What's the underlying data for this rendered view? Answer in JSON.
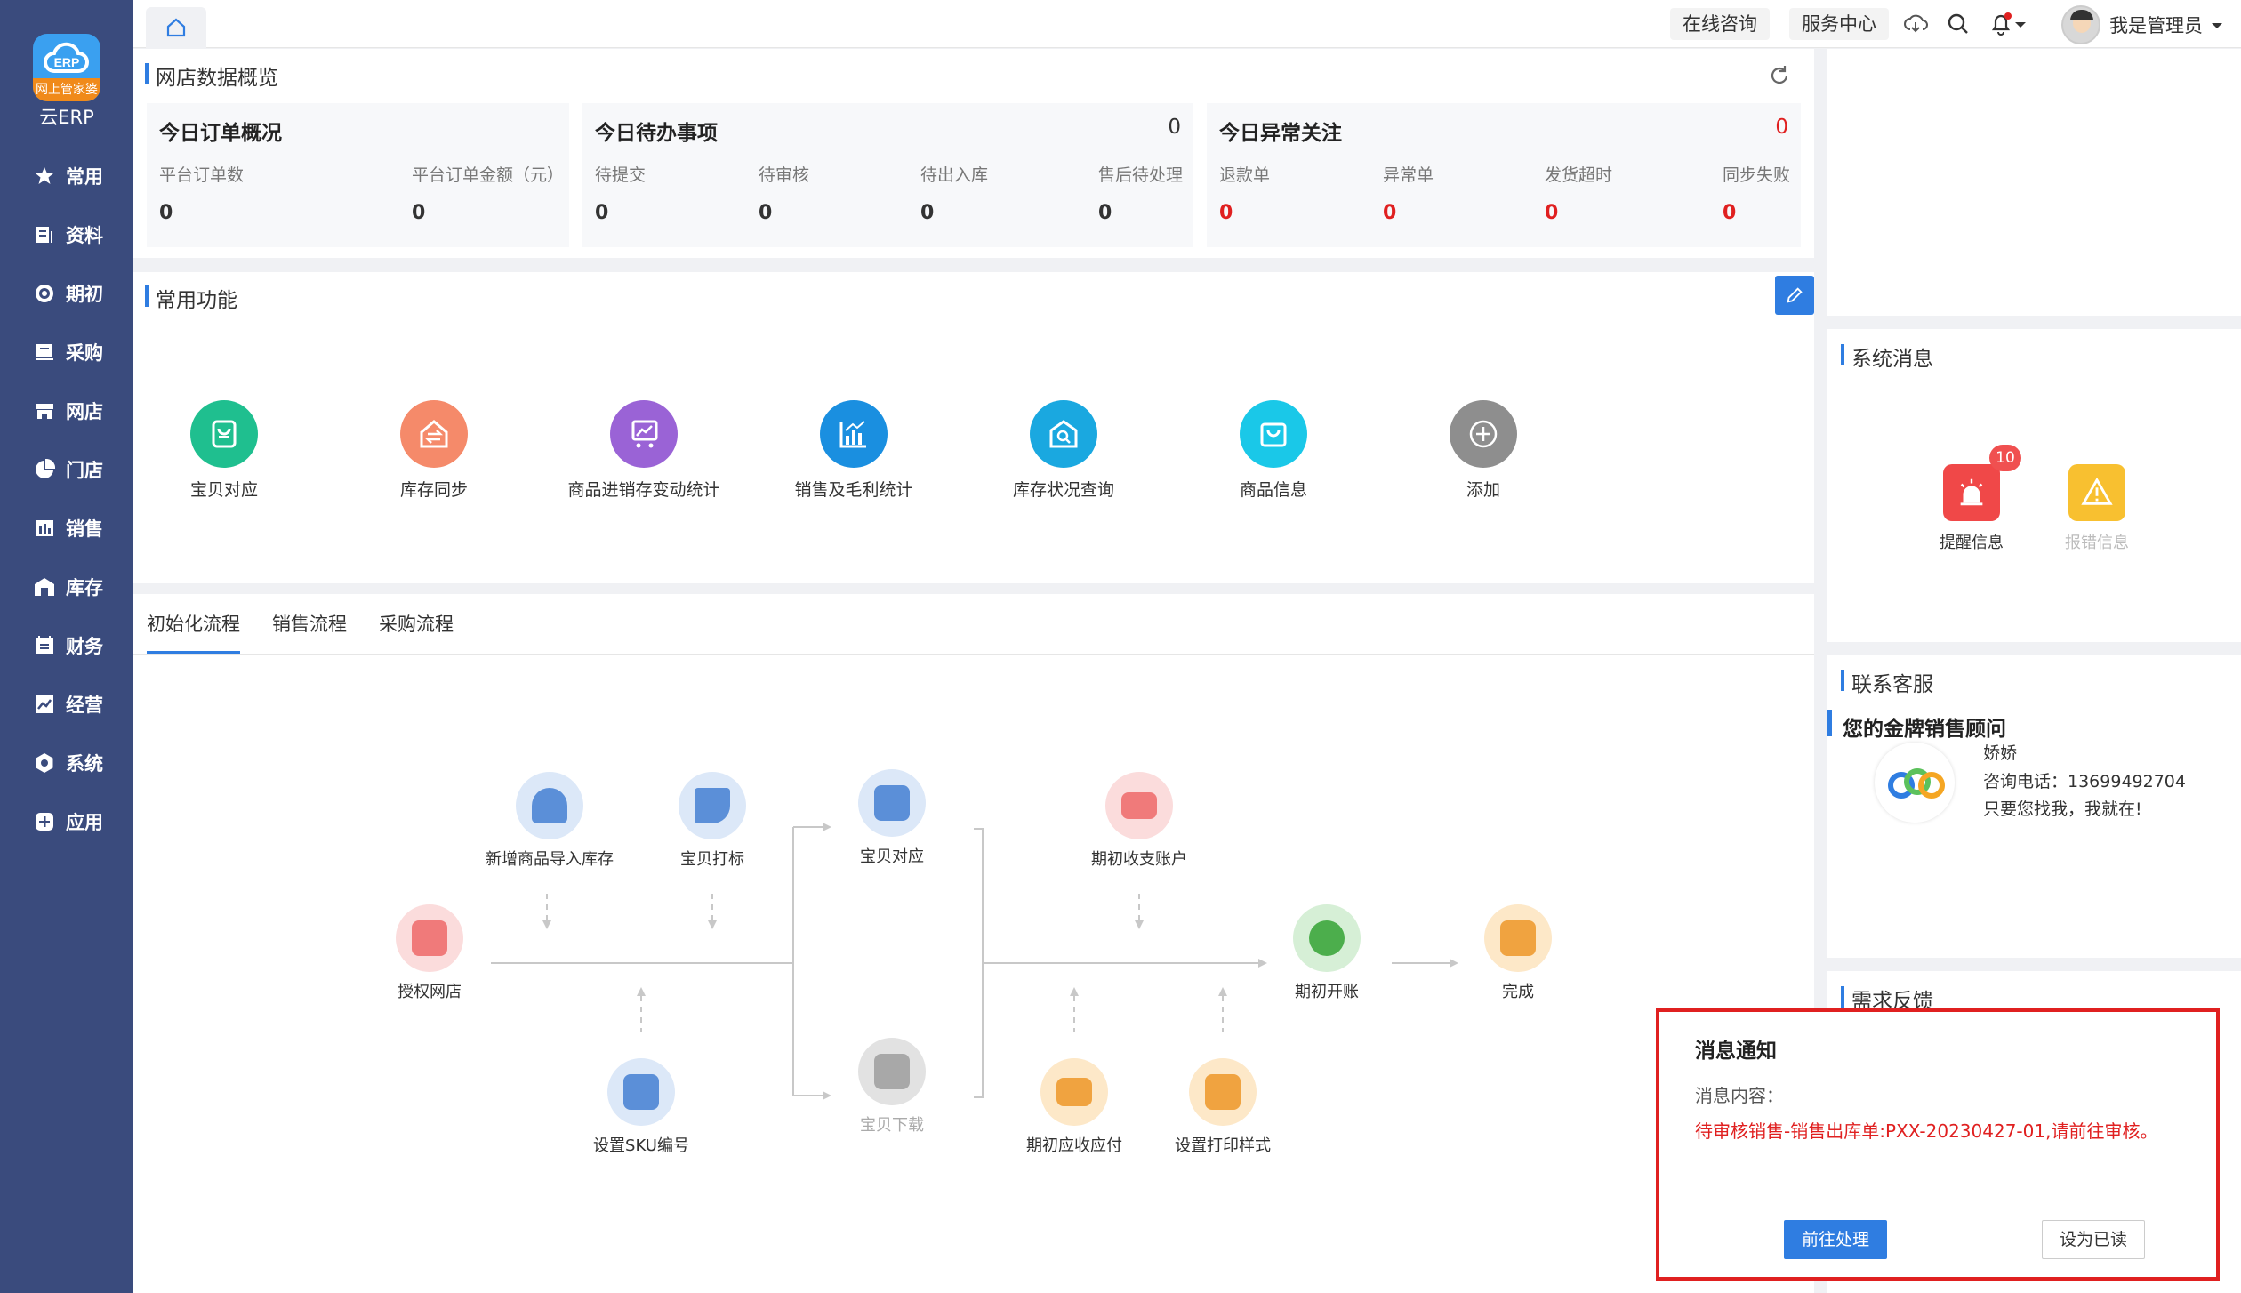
{
  "app": {
    "logo_tag": "网上管家婆",
    "logo_text": "云ERP"
  },
  "sidebar": {
    "items": [
      {
        "label": "常用",
        "icon": "star-icon"
      },
      {
        "label": "资料",
        "icon": "document-icon"
      },
      {
        "label": "期初",
        "icon": "target-icon"
      },
      {
        "label": "采购",
        "icon": "purchase-icon"
      },
      {
        "label": "网店",
        "icon": "store-icon"
      },
      {
        "label": "门店",
        "icon": "pie-icon"
      },
      {
        "label": "销售",
        "icon": "sales-icon"
      },
      {
        "label": "库存",
        "icon": "warehouse-icon"
      },
      {
        "label": "财务",
        "icon": "finance-icon"
      },
      {
        "label": "经营",
        "icon": "chart-icon"
      },
      {
        "label": "系统",
        "icon": "gear-icon"
      },
      {
        "label": "应用",
        "icon": "plus-square-icon"
      }
    ]
  },
  "topbar": {
    "online_consult": "在线咨询",
    "service_center": "服务中心",
    "user_name": "我是管理员"
  },
  "overview": {
    "title": "网店数据概览",
    "order_card": {
      "title": "今日订单概况",
      "cols": [
        {
          "label": "平台订单数",
          "value": "0"
        },
        {
          "label": "平台订单金额（元）",
          "value": "0"
        }
      ]
    },
    "todo_card": {
      "title": "今日待办事项",
      "count": "0",
      "cols": [
        {
          "label": "待提交",
          "value": "0"
        },
        {
          "label": "待审核",
          "value": "0"
        },
        {
          "label": "待出入库",
          "value": "0"
        },
        {
          "label": "售后待处理",
          "value": "0"
        }
      ]
    },
    "abnormal_card": {
      "title": "今日异常关注",
      "count": "0",
      "cols": [
        {
          "label": "退款单",
          "value": "0"
        },
        {
          "label": "异常单",
          "value": "0"
        },
        {
          "label": "发货超时",
          "value": "0"
        },
        {
          "label": "同步失败",
          "value": "0"
        }
      ]
    }
  },
  "functions": {
    "title": "常用功能",
    "items": [
      {
        "label": "宝贝对应",
        "color": "#1fbf8f"
      },
      {
        "label": "库存同步",
        "color": "#f58a6a"
      },
      {
        "label": "商品进销存变动统计",
        "color": "#9a63d6"
      },
      {
        "label": "销售及毛利统计",
        "color": "#1a8fe0"
      },
      {
        "label": "库存状况查询",
        "color": "#1aa8e0"
      },
      {
        "label": "商品信息",
        "color": "#1ac8e8"
      },
      {
        "label": "添加",
        "color": "#8e8e8e"
      }
    ]
  },
  "flow": {
    "tabs": [
      "初始化流程",
      "销售流程",
      "采购流程"
    ],
    "nodes": {
      "auth_store": "授权网店",
      "import_goods": "新增商品导入库存",
      "tag_item": "宝贝打标",
      "set_sku": "设置SKU编号",
      "item_match": "宝贝对应",
      "item_download": "宝贝下载",
      "init_account": "期初收支账户",
      "init_receivable": "期初应收应付",
      "print_style": "设置打印样式",
      "open_account": "期初开账",
      "done": "完成"
    }
  },
  "right": {
    "sys_msg_title": "系统消息",
    "remind_label": "提醒信息",
    "remind_badge": "10",
    "error_label": "报错信息",
    "contact_title": "联系客服",
    "advisor_title": "您的金牌销售顾问",
    "advisor_name": "娇娇",
    "advisor_phone": "咨询电话：13699492704",
    "advisor_slogan": "只要您找我，我就在!",
    "feedback_title": "需求反馈"
  },
  "notification": {
    "title": "消息通知",
    "content_label": "消息内容：",
    "content": "待审核销售-销售出库单:PXX-20230427-01,请前往审核。",
    "primary_btn": "前往处理",
    "default_btn": "设为已读"
  }
}
